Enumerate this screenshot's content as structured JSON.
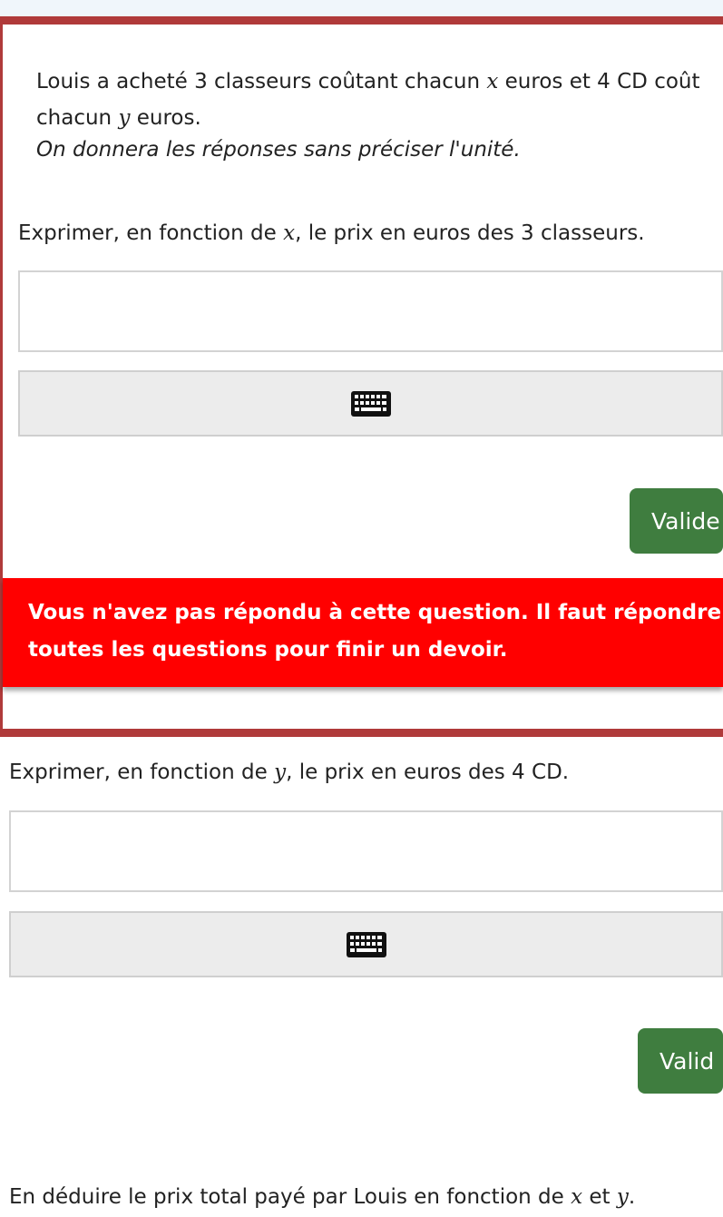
{
  "intro": {
    "part1": "Louis a acheté 3 classeurs coûtant chacun ",
    "var_x": "x",
    "part2": " euros et 4 CD coût",
    "part3": "chacun ",
    "var_y": "y",
    "part4": " euros."
  },
  "note": "On donnera les réponses sans préciser l'unité.",
  "questions": [
    {
      "prefix": "Exprimer, en fonction de ",
      "var": "x",
      "suffix": ", le prix en euros des 3 classeurs.",
      "answer_value": "",
      "button_label": "Valide",
      "error_line1": "Vous n'avez pas répondu à cette question. Il faut répondre",
      "error_line2": "toutes les questions pour finir un devoir."
    },
    {
      "prefix": "Exprimer, en fonction de ",
      "var": "y",
      "suffix": ", le prix en euros des 4 CD.",
      "answer_value": "",
      "button_label": "Valid"
    },
    {
      "prefix": "En déduire le prix total payé par Louis en fonction de ",
      "var_x": "x",
      "middle": " et ",
      "var_y": "y",
      "suffix": "."
    }
  ],
  "icons": {
    "keyboard": "keyboard-icon"
  },
  "colors": {
    "card_border": "#b03a3a",
    "error_bg": "#ff0000",
    "button_bg": "#3f7d3f"
  }
}
